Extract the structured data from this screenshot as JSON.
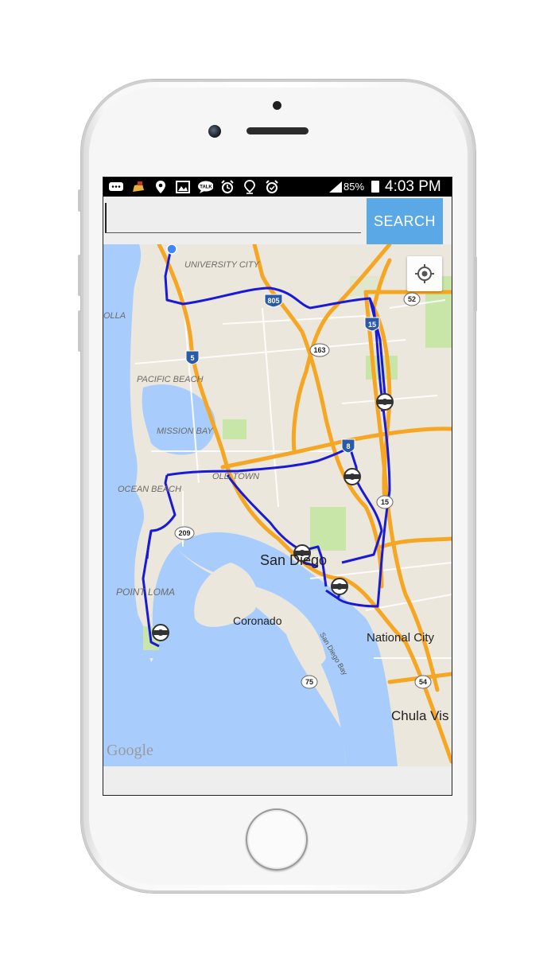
{
  "status_bar": {
    "battery_percent": "85%",
    "time": "4:03 PM",
    "network": "4G",
    "icons": [
      "messages-icon",
      "app-icon",
      "location-icon",
      "image-icon",
      "talk-icon",
      "alarm-icon",
      "location-icon",
      "alarm-icon",
      "signal-icon",
      "battery-icon"
    ],
    "talk_label": "TALK"
  },
  "search": {
    "value": "",
    "button_label": "SEARCH"
  },
  "map": {
    "place_labels": {
      "university_city": "UNIVERSITY CITY",
      "la_jolla": "OLLA",
      "pacific_beach": "PACIFIC BEACH",
      "mission_bay": "MISSION BAY",
      "old_town": "OLD TOWN",
      "ocean_beach": "OCEAN BEACH",
      "point_loma": "POINT LOMA",
      "san_diego": "San Diego",
      "coronado": "Coronado",
      "national_city": "National City",
      "chula_vista": "Chula Vis",
      "san_diego_bay": "San Diego Bay"
    },
    "highway_shields": {
      "i805": "805",
      "i5": "5",
      "i15": "15",
      "i8": "8",
      "r52": "52",
      "r163": "163",
      "r209": "209",
      "r75": "75",
      "r54": "54",
      "r15b": "15"
    },
    "attribution": "Google",
    "route_color": "#1a1ad6",
    "marker_count": 7
  }
}
